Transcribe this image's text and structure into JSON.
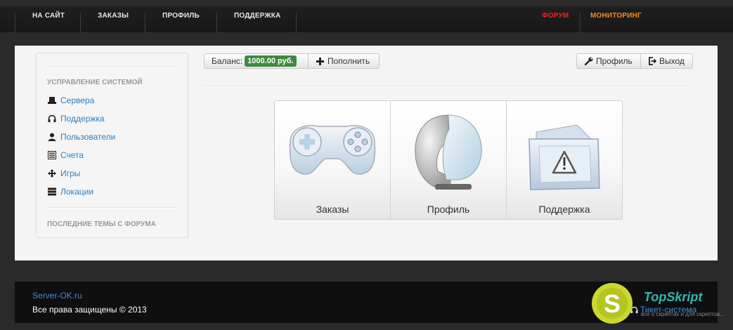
{
  "nav": {
    "items": [
      "НА САЙТ",
      "ЗАКАЗЫ",
      "ПРОФИЛЬ",
      "ПОДДЕРЖКА"
    ],
    "forum": "ФОРУМ",
    "monitoring": "МОНИТОРИНГ"
  },
  "sidebar": {
    "section_title": "УСПРАВЛЕНИЕ СИСТЕМОЙ",
    "items": [
      {
        "label": "Сервера",
        "icon": "hdd-icon"
      },
      {
        "label": "Поддержка",
        "icon": "headphones-icon"
      },
      {
        "label": "Пользователи",
        "icon": "user-icon"
      },
      {
        "label": "Счета",
        "icon": "list-icon"
      },
      {
        "label": "Игры",
        "icon": "move-icon"
      },
      {
        "label": "Локации",
        "icon": "server-icon"
      }
    ],
    "forum_title": "ПОСЛЕДНИЕ ТЕМЫ С ФОРУМА"
  },
  "toolbar": {
    "balance_label": "Баланс:",
    "balance_value": "1000.00 руб.",
    "topup_label": "Пополнить",
    "profile_label": "Профиль",
    "logout_label": "Выход"
  },
  "tiles": [
    {
      "label": "Заказы",
      "icon": "gamepad-icon"
    },
    {
      "label": "Профиль",
      "icon": "helmet-icon"
    },
    {
      "label": "Поддержка",
      "icon": "warning-folder-icon"
    }
  ],
  "footer": {
    "site_link": "Server-OK.ru",
    "copyright": "Все права защищены © 2013",
    "ticket_system": "Тикет-система"
  },
  "watermark": {
    "brand": "TopSkript",
    "tagline": "все о скриптах и для скриптов..."
  }
}
